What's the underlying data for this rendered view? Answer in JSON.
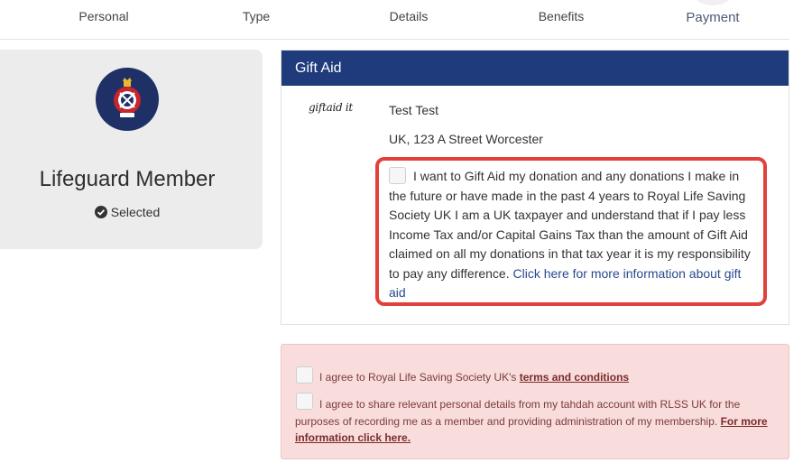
{
  "steps": [
    "Personal",
    "Type",
    "Details",
    "Benefits",
    "Payment"
  ],
  "membership": {
    "title": "Lifeguard Member",
    "selected_label": "Selected"
  },
  "gift_aid": {
    "header": "Gift Aid",
    "logo_text": "giftaid it",
    "name": "Test Test",
    "address": "UK, 123 A Street Worcester",
    "declaration": "I want to Gift Aid my donation and any donations I make in the future or have made in the past 4 years to Royal Life Saving Society UK I am a UK taxpayer and understand that if I pay less Income Tax and/or Capital Gains Tax than the amount of Gift Aid claimed on all my donations in that tax year it is my responsibility to pay any difference.",
    "more_info_link": "Click here for more information about gift aid"
  },
  "terms": {
    "terms_text": "I agree to Royal Life Saving Society UK's",
    "terms_link": "terms and conditions",
    "share_text": "I agree to share relevant personal details from my tahdah account with RLSS UK for the purposes of recording me as a member and providing administration of my membership.",
    "share_link": "For more information click here."
  },
  "colors": {
    "header_blue": "#1f3b7c",
    "highlight_red": "#e2403a",
    "terms_bg": "#f9dcdc",
    "logo_blue": "#1e3066"
  }
}
